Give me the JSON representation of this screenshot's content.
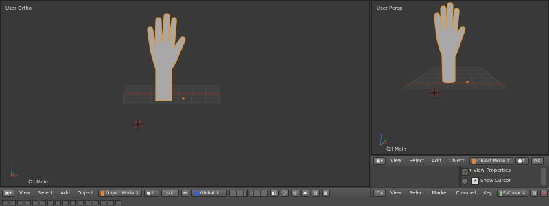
{
  "left_viewport": {
    "view_name": "User Ortho",
    "object_label": "(2) Main"
  },
  "right_viewport": {
    "view_name": "User Persp",
    "object_label": "(2) Main"
  },
  "left_header": {
    "menus": [
      "View",
      "Select",
      "Add",
      "Object"
    ],
    "mode": "Object Mode",
    "transform_orientation": "Global"
  },
  "right_header": {
    "menus": [
      "View",
      "Select",
      "Add",
      "Object"
    ],
    "mode": "Object Mode"
  },
  "properties_panel": {
    "section": "▾ View Properties",
    "show_cursor_label": "Show Cursor",
    "show_cursor_checked": true
  },
  "graph_header": {
    "menus": [
      "View",
      "Select",
      "Marker",
      "Channel",
      "Key"
    ],
    "mode": "F-Curve"
  },
  "colors": {
    "accent_orange": "#e8862a",
    "selection_outline": "#f0a030",
    "axis_red": "#c03030",
    "axis_green": "#3a9a3a",
    "axis_blue": "#3a5fcf"
  }
}
